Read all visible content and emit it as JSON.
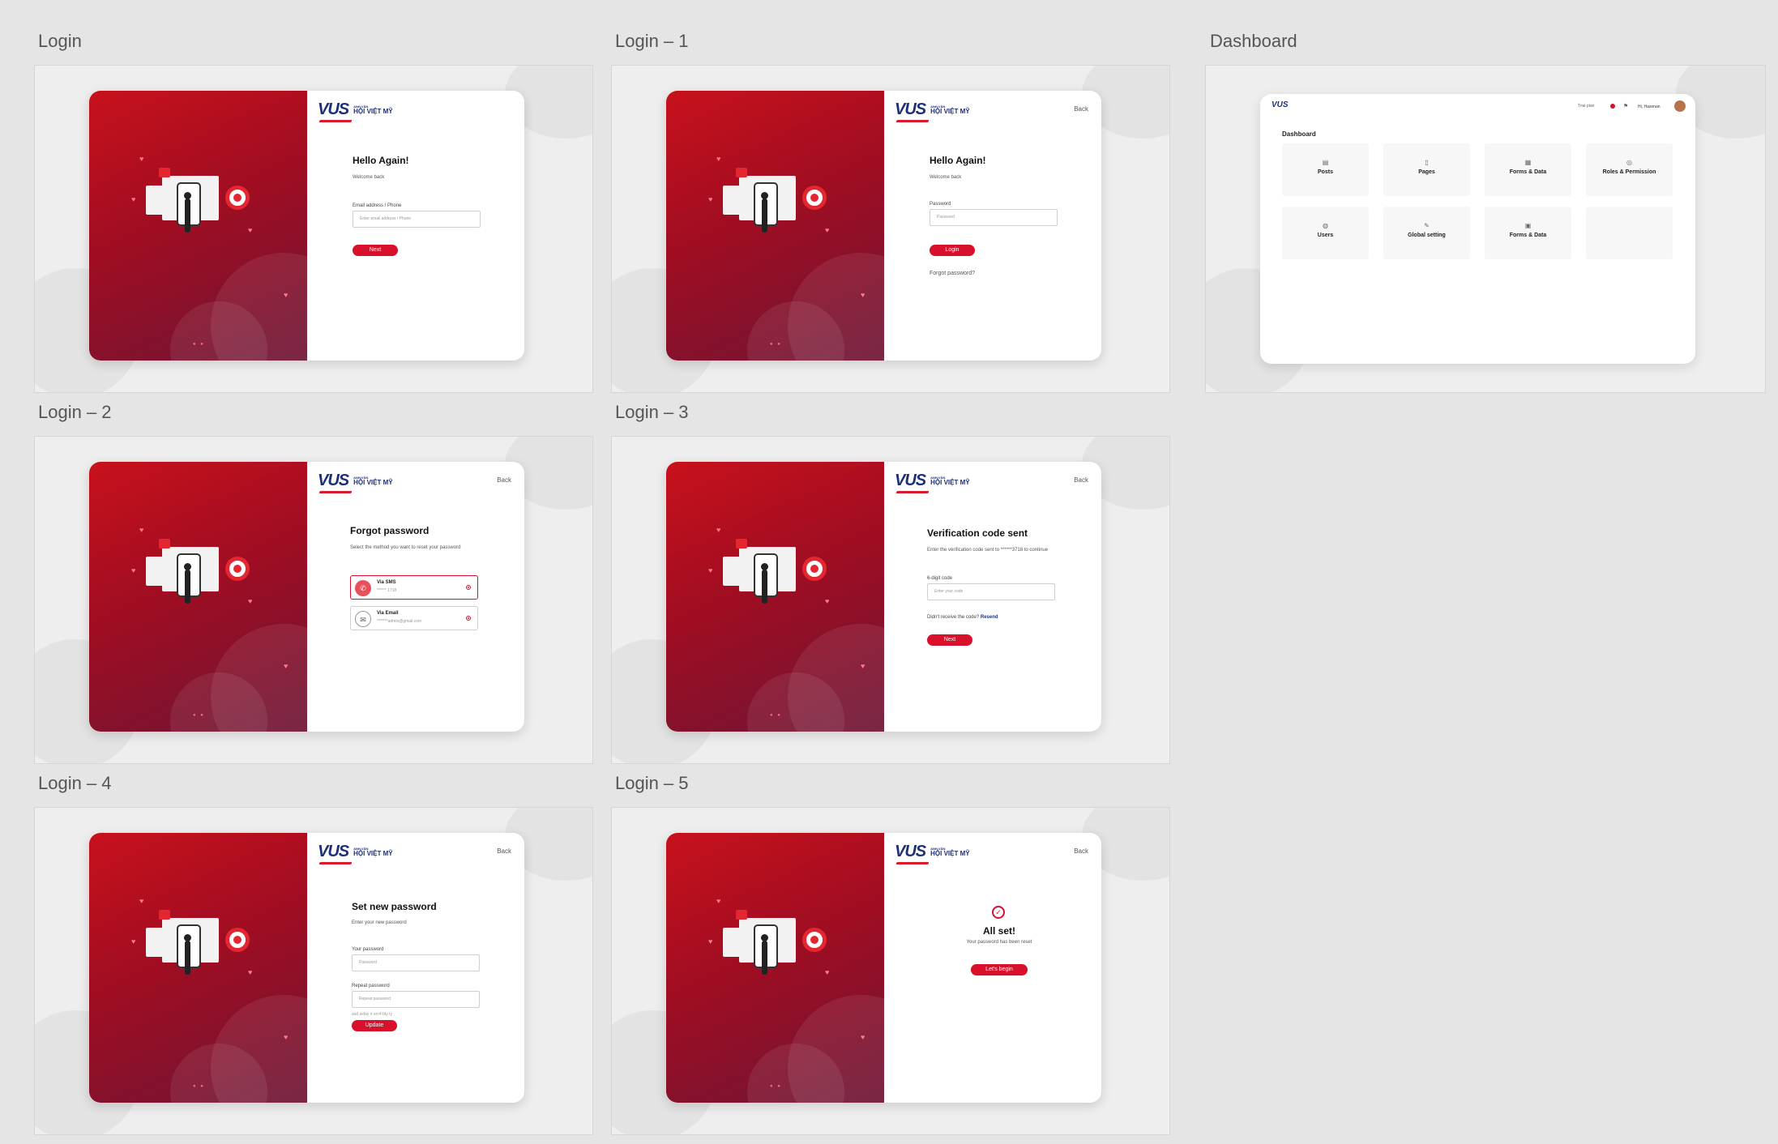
{
  "artboards": {
    "login": "Login",
    "login1": "Login – 1",
    "dashboard": "Dashboard",
    "login2": "Login – 2",
    "login3": "Login – 3",
    "login4": "Login – 4",
    "login5": "Login – 5"
  },
  "brand": {
    "logo": "VUS",
    "small": "ANH VĂN",
    "big": "HỘI VIỆT MỸ"
  },
  "back": "Back",
  "login": {
    "title": "Hello Again!",
    "subtitle": "Welcome back",
    "email_label": "Email address / Phone",
    "email_placeholder": "Enter email address / Phone",
    "next": "Next"
  },
  "login1": {
    "title": "Hello Again!",
    "subtitle": "Welcome back",
    "password_label": "Password",
    "password_placeholder": "Password",
    "login": "Login",
    "forgot": "Forgot password?"
  },
  "login2": {
    "title": "Forgot password",
    "subtitle": "Select the method you want to reset your password",
    "sms_title": "Via SMS",
    "sms_value": "****** 1718",
    "email_title": "Via Email",
    "email_value": "*******admin@gmail.com"
  },
  "login3": {
    "title": "Verification code sent",
    "subtitle": "Enter the verification code sent to ******3718 to continue",
    "code_label": "6-digit code",
    "code_placeholder": "Enter your code",
    "resend_prompt": "Didn't receive the code?",
    "resend": "Resend",
    "next": "Next"
  },
  "login4": {
    "title": "Set new password",
    "subtitle": "Enter your new password",
    "pw_label": "Your password",
    "pw_placeholder": "Password",
    "repeat_label": "Repeat password",
    "repeat_placeholder": "Repeat password",
    "hint": "asd asfay ir erc4 bty ty",
    "update": "Update"
  },
  "login5": {
    "title": "All set!",
    "subtitle": "Your password has been reset",
    "begin": "Let's begin"
  },
  "dashboard": {
    "trial": "Trial plan",
    "greeting": "Hi, Hazenan",
    "heading": "Dashboard",
    "tiles": [
      "Posts",
      "Pages",
      "Forms & Data",
      "Roles & Permission",
      "Users",
      "Global setting",
      "Forms & Data",
      ""
    ]
  },
  "colors": {
    "accent": "#d8102b",
    "brand_navy": "#1d2f7a",
    "hero_start": "#c8111c",
    "hero_end": "#6e1535"
  }
}
